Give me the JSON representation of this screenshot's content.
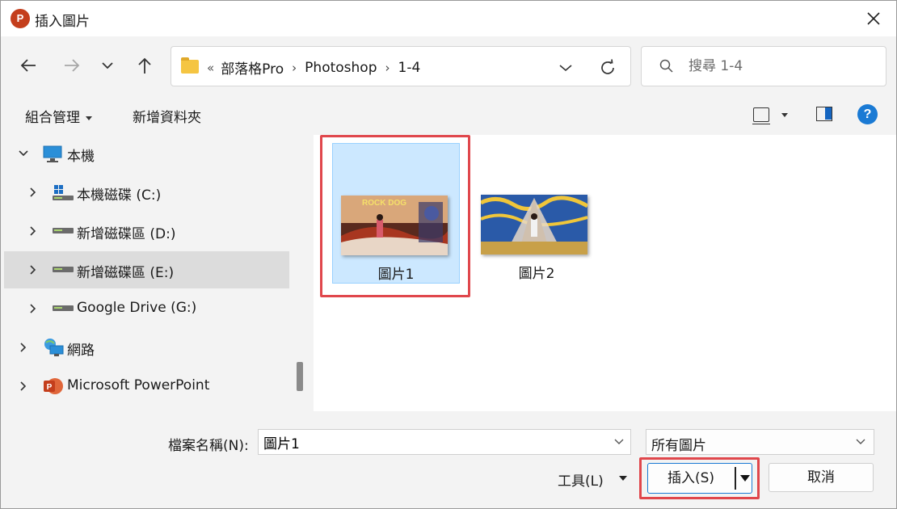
{
  "window": {
    "title": "插入圖片",
    "app_logo": "P"
  },
  "navigation": {
    "breadcrumb_overflow": "«",
    "breadcrumbs": [
      "部落格Pro",
      "Photoshop",
      "1-4"
    ],
    "search_placeholder": "搜尋 1-4"
  },
  "toolbar": {
    "organize_label": "組合管理",
    "new_folder_label": "新增資料夾",
    "help_label": "?"
  },
  "tree": {
    "items": [
      {
        "label": "本機",
        "expanded": true
      },
      {
        "label": "本機磁碟 (C:)"
      },
      {
        "label": "新增磁碟區 (D:)"
      },
      {
        "label": "新增磁碟區 (E:)",
        "selected": true
      },
      {
        "label": "Google Drive (G:)"
      },
      {
        "label": "網路"
      },
      {
        "label": "Microsoft PowerPoint"
      }
    ]
  },
  "files": [
    {
      "name": "圖片1",
      "selected": true,
      "thumb_text": "ROCK DOG"
    },
    {
      "name": "圖片2",
      "selected": false
    }
  ],
  "bottom": {
    "filename_label": "檔案名稱(N):",
    "filename_value": "圖片1",
    "filetype_label": "所有圖片",
    "tools_label": "工具(L)",
    "insert_label": "插入(S)",
    "cancel_label": "取消"
  },
  "colors": {
    "accent": "#1a7ad4",
    "selection": "#cce8ff",
    "highlight_box": "#e0474c",
    "powerpoint": "#c43e1c"
  }
}
